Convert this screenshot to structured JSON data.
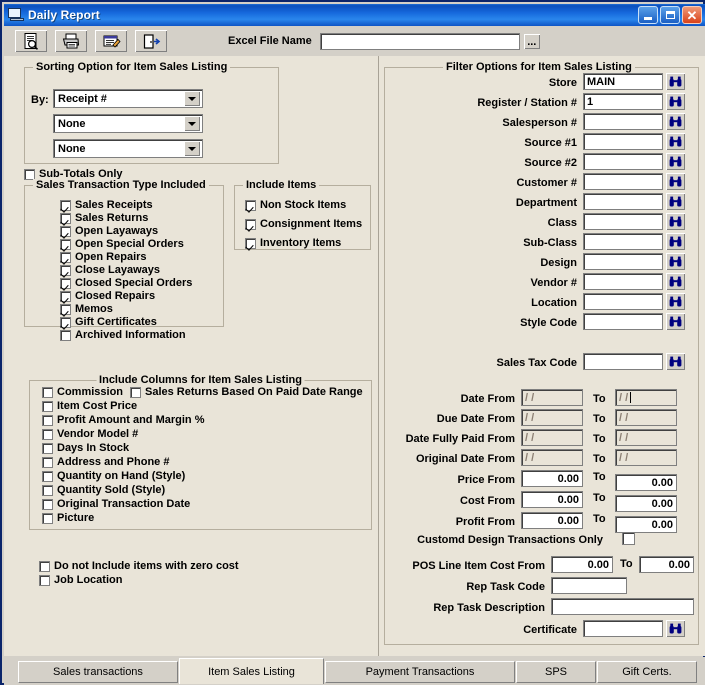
{
  "window": {
    "title": "Daily Report",
    "icon": "monitor-icon",
    "buttons": {
      "minimize": "_",
      "maximize": "□",
      "close": "✕"
    }
  },
  "toolbar": {
    "buttons": [
      {
        "name": "preview-button",
        "icon": "document-preview-icon"
      },
      {
        "name": "print-button",
        "icon": "printer-icon"
      },
      {
        "name": "report-button",
        "icon": "form-pencil-icon"
      },
      {
        "name": "exit-button",
        "icon": "exit-door-icon"
      }
    ],
    "excel_label": "Excel File Name",
    "excel_value": "",
    "excel_placeholder": "",
    "browse_label": "..."
  },
  "sorting": {
    "legend": "Sorting Option for Item Sales Listing",
    "by_label": "By:",
    "selects": [
      {
        "name": "sort-by-1",
        "value": "Receipt #"
      },
      {
        "name": "sort-by-2",
        "value": "None"
      },
      {
        "name": "sort-by-3",
        "value": "None"
      }
    ],
    "subtotals": {
      "label": "Sub-Totals Only",
      "checked": false
    }
  },
  "transaction_types": {
    "legend": "Sales Transaction Type Included",
    "items": [
      {
        "label": "Sales Receipts",
        "checked": true
      },
      {
        "label": "Sales Returns",
        "checked": true
      },
      {
        "label": "Open Layaways",
        "checked": true
      },
      {
        "label": "Open Special Orders",
        "checked": true
      },
      {
        "label": "Open Repairs",
        "checked": true
      },
      {
        "label": "Close Layaways",
        "checked": true
      },
      {
        "label": "Closed Special Orders",
        "checked": true
      },
      {
        "label": "Closed Repairs",
        "checked": true
      },
      {
        "label": "Memos",
        "checked": true
      },
      {
        "label": "Gift Certificates",
        "checked": true
      },
      {
        "label": "Archived Information",
        "checked": false
      }
    ]
  },
  "include_items": {
    "legend": "Include Items",
    "items": [
      {
        "label": "Non Stock Items",
        "checked": true
      },
      {
        "label": "Consignment Items",
        "checked": true
      },
      {
        "label": "Inventory Items",
        "checked": true
      }
    ]
  },
  "include_columns": {
    "legend": "Include Columns for Item Sales Listing",
    "items": [
      {
        "label": "Commission",
        "checked": false
      },
      {
        "label": "Item Cost Price",
        "checked": false
      },
      {
        "label": "Profit Amount and Margin %",
        "checked": false
      },
      {
        "label": "Vendor Model #",
        "checked": false
      },
      {
        "label": "Days In Stock",
        "checked": false
      },
      {
        "label": "Address and Phone #",
        "checked": false
      },
      {
        "label": "Quantity on Hand (Style)",
        "checked": false
      },
      {
        "label": "Quantity Sold (Style)",
        "checked": false
      },
      {
        "label": "Original Transaction Date",
        "checked": false
      },
      {
        "label": "Picture",
        "checked": false
      }
    ],
    "paid_date_range": {
      "label": "Sales Returns Based On Paid Date Range",
      "checked": false
    }
  },
  "bottom_options": [
    {
      "label": "Do not Include items with zero cost",
      "checked": false
    },
    {
      "label": "Job Location",
      "checked": false
    }
  ],
  "filter": {
    "legend": "Filter Options for Item Sales Listing",
    "lookup_icon": "binoculars-icon",
    "fields": [
      {
        "label": "Store",
        "value": "MAIN",
        "lookup": true
      },
      {
        "label": "Register / Station #",
        "value": "1",
        "lookup": true
      },
      {
        "label": "Salesperson #",
        "value": "",
        "lookup": true
      },
      {
        "label": "Source #1",
        "value": "",
        "lookup": true
      },
      {
        "label": "Source #2",
        "value": "",
        "lookup": true
      },
      {
        "label": "Customer #",
        "value": "",
        "lookup": true
      },
      {
        "label": "Department",
        "value": "",
        "lookup": true
      },
      {
        "label": "Class",
        "value": "",
        "lookup": true
      },
      {
        "label": "Sub-Class",
        "value": "",
        "lookup": true
      },
      {
        "label": "Design",
        "value": "",
        "lookup": true
      },
      {
        "label": "Vendor #",
        "value": "",
        "lookup": true
      },
      {
        "label": "Location",
        "value": "",
        "lookup": true
      },
      {
        "label": "Style Code",
        "value": "",
        "lookup": true
      }
    ],
    "sales_tax_code": {
      "label": "Sales Tax Code",
      "value": "",
      "lookup": true
    },
    "to_label": "To",
    "ranges": [
      {
        "label": "Date From",
        "from": "/ /",
        "to": "/ /",
        "type": "date",
        "caret": true
      },
      {
        "label": "Due Date From",
        "from": "/ /",
        "to": "/ /",
        "type": "date",
        "caret": false
      },
      {
        "label": "Date Fully Paid From",
        "from": "/ /",
        "to": "/ /",
        "type": "date",
        "caret": false
      },
      {
        "label": "Original Date From",
        "from": "/ /",
        "to": "/ /",
        "type": "date",
        "caret": false
      },
      {
        "label": "Price From",
        "from": "0.00",
        "to": "0.00",
        "type": "number",
        "caret": false
      },
      {
        "label": "Cost From",
        "from": "0.00",
        "to": "0.00",
        "type": "number",
        "caret": false
      },
      {
        "label": "Profit From",
        "from": "0.00",
        "to": "0.00",
        "type": "number",
        "caret": false
      }
    ],
    "custom_design": {
      "label": "Customd Design Transactions Only",
      "checked": false
    },
    "pos_line": {
      "label": "POS Line Item Cost From",
      "from": "0.00",
      "to": "0.00",
      "to_label": "To"
    },
    "rep_task_code": {
      "label": "Rep Task Code",
      "value": ""
    },
    "rep_task_description": {
      "label": "Rep Task Description",
      "value": ""
    },
    "certificate": {
      "label": "Certificate",
      "value": "",
      "lookup": true
    }
  },
  "tabs": [
    {
      "label": "Sales transactions",
      "active": false
    },
    {
      "label": "Item Sales Listing",
      "active": true
    },
    {
      "label": "Payment Transactions",
      "active": false
    },
    {
      "label": "SPS",
      "active": false
    },
    {
      "label": "Gift Certs.",
      "active": false
    }
  ],
  "colors": {
    "title_bar": "#0a4fbd",
    "client_bg": "#e9e4d8",
    "chrome_bg": "#d4d0c8",
    "lookup_icon": "#000080"
  }
}
